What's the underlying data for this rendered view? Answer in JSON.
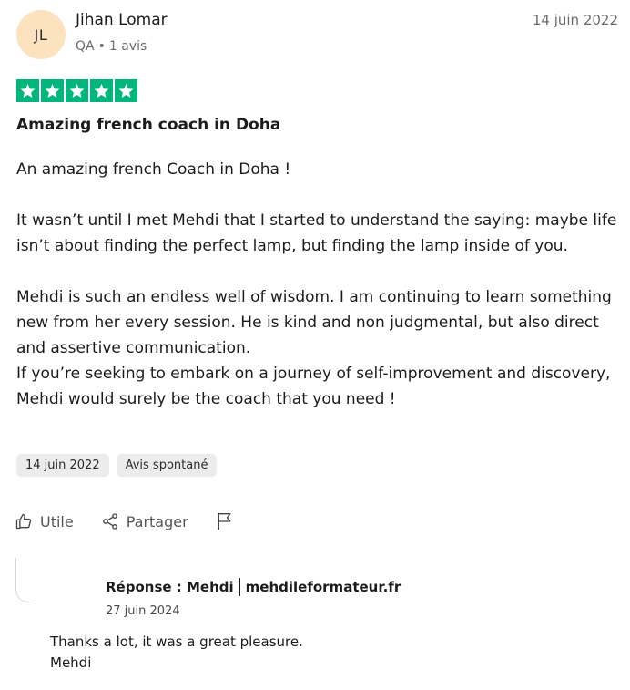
{
  "reviewer": {
    "initials": "JL",
    "name": "Jihan Lomar",
    "country": "QA",
    "separator": "•",
    "review_count": "1 avis",
    "avatar_color": "#fde2c0"
  },
  "review": {
    "date_top": "14 juin 2022",
    "rating": 5,
    "star_color": "#00b67a",
    "title": "Amazing french coach in Doha",
    "body": {
      "line1": "An amazing french Coach in Doha !",
      "line2": "It wasn’t until I met Mehdi that I started to understand the saying: maybe life isn’t about finding the perfect lamp, but finding the lamp inside of you.",
      "line3": "Mehdi is such an endless well of wisdom. I am continuing to learn something new from her every session. He is kind and non judgmental, but also direct and assertive communication.",
      "line4": "If you’re seeking to embark on a journey of self-improvement and discovery, Mehdi would surely be the coach that you need !"
    },
    "tags": {
      "date": "14 juin 2022",
      "type": "Avis spontané"
    }
  },
  "actions": {
    "useful_label": "Utile",
    "share_label": "Partager",
    "useful_icon": "thumbs-up-icon",
    "share_icon": "share-icon",
    "flag_icon": "flag-icon"
  },
  "reply": {
    "label": "Réponse : Mehdi",
    "company": "mehdileformateur.fr",
    "date": "27 juin 2024",
    "line1": "Thanks a lot, it was a great pleasure.",
    "line2": "Mehdi"
  }
}
